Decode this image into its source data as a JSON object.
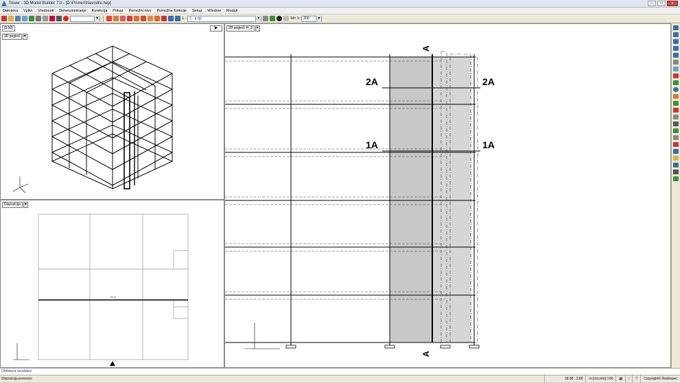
{
  "window": {
    "title": "Tower - 3D Model Builder 7.0 - [D:\\Primeri\\Navodilo.twp]"
  },
  "menu": [
    "Datoteka",
    "Vplivi",
    "Vrednosti",
    "Dimenzioniranje",
    "Korekcija",
    "Prikaz",
    "Pomožni nivo",
    "Pomožne funkcije",
    "Setup",
    "Window",
    "Moduli"
  ],
  "toolbar": {
    "level_combo": "",
    "layer_combo": "1 - g (g)",
    "scale_label": "M= 1:",
    "scale_value": "200"
  },
  "pane_3d": {
    "zoom_label": "[3.00]",
    "view_select": "3D pogled"
  },
  "pane_disp": {
    "view_select": "Dispozicija",
    "axis_label": "H_3"
  },
  "pane_2d": {
    "view_select": "2D pogled: H_3"
  },
  "drawing": {
    "section_a": "A",
    "section_2a_left": "2A",
    "section_2a_right": "2A",
    "section_1a_left": "1A",
    "section_1a_right": "1A"
  },
  "status": {
    "message": "Obdelava rezultatov",
    "mode": "Dispozicija prerezov",
    "coords": "18.68 , 3.89",
    "units": "m [cm,mm] / kN",
    "copyright": "Copyright© Radimpex"
  },
  "colors": {
    "shade": "#c8c8c8",
    "accent": "#3a6ea5"
  }
}
